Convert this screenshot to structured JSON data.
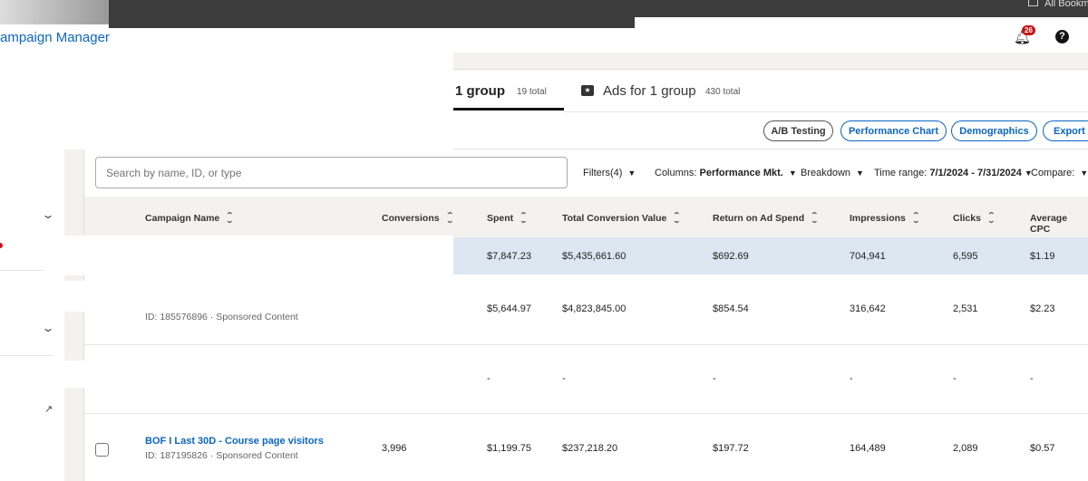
{
  "app": {
    "title": "ampaign Manager",
    "bookmarks": "All Bookm",
    "notifications": "26"
  },
  "tabs": [
    {
      "label": "1 group",
      "count": "19 total"
    },
    {
      "label": "Ads for 1 group",
      "count": "430 total"
    }
  ],
  "actions": [
    "A/B Testing",
    "Performance Chart",
    "Demographics",
    "Export"
  ],
  "search": {
    "placeholder": "Search by name, ID, or type"
  },
  "toolbar": {
    "filters": "Filters(4)",
    "columns_label": "Columns:",
    "columns_value": "Performance Mkt.",
    "breakdown": "Breakdown",
    "time_label": "Time range:",
    "time_value": "7/1/2024 - 7/31/2024",
    "compare": "Compare:"
  },
  "columns": [
    "Campaign Name",
    "Conversions",
    "Spent",
    "Total Conversion Value",
    "Return on Ad Spend",
    "Impressions",
    "Clicks",
    "Average CPC"
  ],
  "rows": [
    {
      "name": "",
      "sub": "",
      "conv": "",
      "spent": "$7,847.23",
      "tcv": "$5,435,661.60",
      "roas": "$692.69",
      "impr": "704,941",
      "clicks": "6,595",
      "cpc": "$1.19"
    },
    {
      "name": "",
      "sub": "ID: 185576896 · Sponsored Content",
      "conv": "",
      "spent": "$5,644.97",
      "tcv": "$4,823,845.00",
      "roas": "$854.54",
      "impr": "316,642",
      "clicks": "2,531",
      "cpc": "$2.23"
    },
    {
      "name": "",
      "sub": "",
      "conv": "",
      "spent": "-",
      "tcv": "-",
      "roas": "-",
      "impr": "-",
      "clicks": "-",
      "cpc": "-"
    },
    {
      "name": "BOF I Last 30D - Course page visitors",
      "sub": "ID: 187195826 · Sponsored Content",
      "conv": "3,996",
      "spent": "$1,199.75",
      "tcv": "$237,218.20",
      "roas": "$197.72",
      "impr": "164,489",
      "clicks": "2,089",
      "cpc": "$0.57"
    }
  ],
  "colors": {
    "brand": "#0a66c2",
    "total_row": "#dde7f1",
    "gray": "#f3f2ef"
  }
}
